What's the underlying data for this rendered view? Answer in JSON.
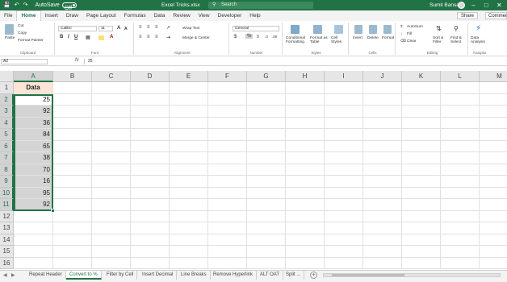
{
  "titlebar": {
    "autosave_label": "AutoSave",
    "autosave_state": "Off",
    "file_title": "Excel Tricks.xlsx",
    "search_placeholder": "Search",
    "user_name": "Sumit Bansal"
  },
  "menu": {
    "tabs": [
      "File",
      "Home",
      "Insert",
      "Draw",
      "Page Layout",
      "Formulas",
      "Data",
      "Review",
      "View",
      "Developer",
      "Help"
    ],
    "active": "Home",
    "share_label": "Share",
    "comments_label": "Comments"
  },
  "ribbon": {
    "clipboard": {
      "label": "Clipboard",
      "paste": "Paste",
      "cut": "Cut",
      "copy": "Copy",
      "format_painter": "Format Painter"
    },
    "font": {
      "label": "Font",
      "font_name": "Calibri",
      "font_size": "11"
    },
    "alignment": {
      "label": "Alignment",
      "wrap_text": "Wrap Text",
      "merge_center": "Merge & Center"
    },
    "number": {
      "label": "Number",
      "format": "General"
    },
    "styles": {
      "label": "Styles",
      "conditional": "Conditional Formatting",
      "format_table": "Format as Table",
      "cell_styles": "Cell Styles"
    },
    "cells": {
      "label": "Cells",
      "insert": "Insert",
      "delete": "Delete",
      "format": "Format"
    },
    "editing": {
      "label": "Editing",
      "autosum": "AutoSum",
      "fill": "Fill",
      "clear": "Clear",
      "sort_filter": "Sort & Filter",
      "find_select": "Find & Select"
    },
    "analysis": {
      "label": "Analysis",
      "data_analysis": "Data Analysis"
    }
  },
  "formula_bar": {
    "name_box": "A2",
    "fx": "fx",
    "value": "25"
  },
  "grid": {
    "columns": [
      "A",
      "B",
      "C",
      "D",
      "E",
      "F",
      "G",
      "H",
      "I",
      "J",
      "K",
      "L",
      "M"
    ],
    "rows": [
      "1",
      "2",
      "3",
      "4",
      "5",
      "6",
      "7",
      "8",
      "9",
      "10",
      "11",
      "12",
      "13",
      "14",
      "15",
      "16"
    ],
    "header_cell": "Data",
    "values": [
      "25",
      "92",
      "36",
      "84",
      "65",
      "38",
      "70",
      "16",
      "95",
      "92"
    ]
  },
  "sheets": {
    "tabs": [
      "Repeat Header",
      "Convert to %",
      "Filter by Cell",
      "Insert Decimal",
      "Line Breaks",
      "Remove Hyperlink",
      "ALT OAT",
      "Split ..."
    ],
    "active": "Convert to %"
  },
  "colors": {
    "accent": "#217346",
    "header_fill": "#fce4d6",
    "selection": "#d4d4d4"
  }
}
